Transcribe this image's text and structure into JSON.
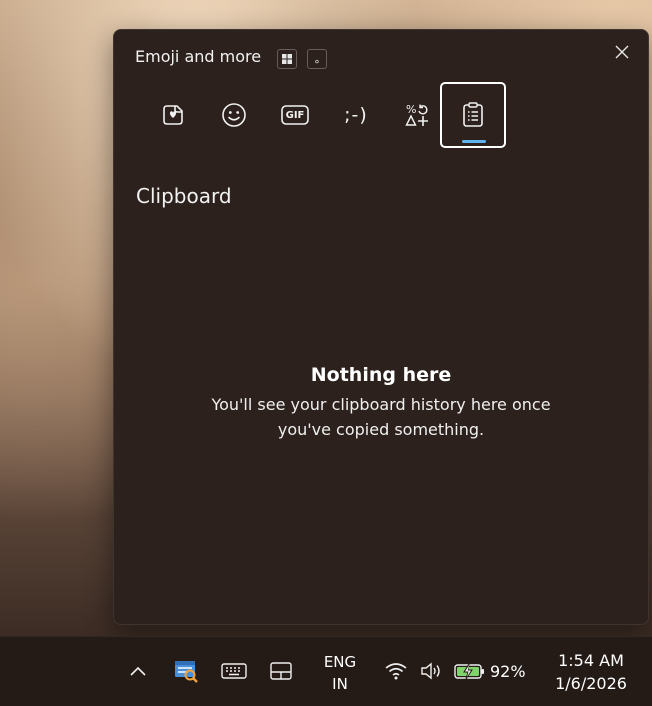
{
  "panel": {
    "title": "Emoji and more",
    "shortcut_key": "∘",
    "tabs": [
      {
        "name": "tab-favorites",
        "icon": "heart-sticker-icon"
      },
      {
        "name": "tab-emoji",
        "icon": "smiley-icon"
      },
      {
        "name": "tab-gif",
        "icon": "gif-icon",
        "label": "GIF"
      },
      {
        "name": "tab-kaomoji",
        "icon": "kaomoji-icon",
        "label": ";-)"
      },
      {
        "name": "tab-symbols",
        "icon": "symbols-icon"
      },
      {
        "name": "tab-clipboard",
        "icon": "clipboard-icon",
        "selected": true
      }
    ],
    "section_title": "Clipboard",
    "empty_title": "Nothing here",
    "empty_desc": "You'll see your clipboard history here once you've copied something."
  },
  "taskbar": {
    "language_line1": "ENG",
    "language_line2": "IN",
    "battery_percent": "92%",
    "time": "1:54 AM",
    "date": "1/6/2026",
    "icons": [
      "chevron-up-icon",
      "search-app-icon",
      "touch-keyboard-icon",
      "pen-tablet-icon",
      "wifi-icon",
      "volume-icon",
      "battery-icon"
    ]
  },
  "colors": {
    "panel_bg": "#2c211c",
    "accent": "#60b3f0",
    "taskbar_bg": "#241b17",
    "battery_fill": "#7ed36a"
  }
}
